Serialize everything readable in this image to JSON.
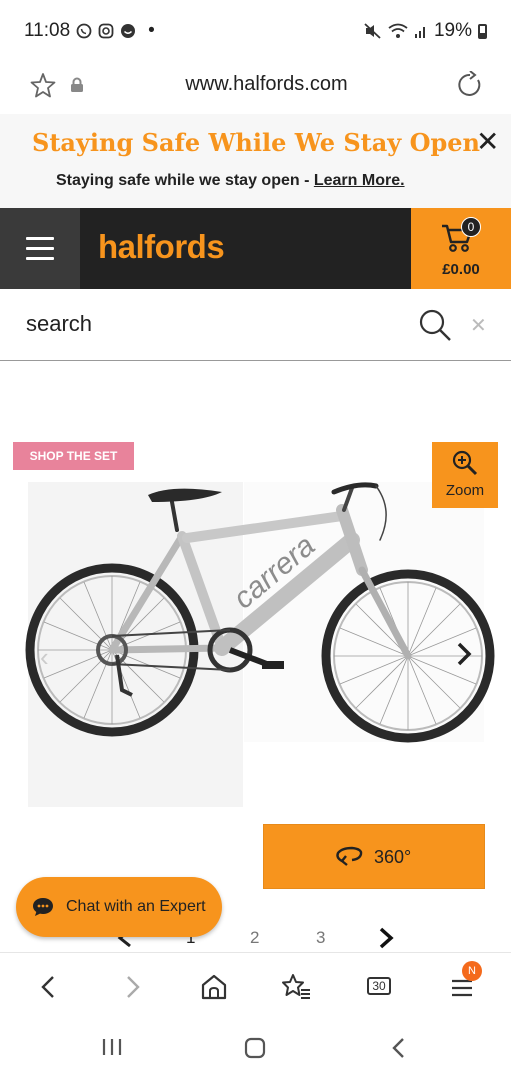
{
  "status_bar": {
    "time": "11:08",
    "dot": "•",
    "battery": "19%"
  },
  "browser": {
    "url": "www.halfords.com"
  },
  "promo": {
    "title": "Staying Safe While We Stay Open",
    "close": "✕",
    "subtitle": "Staying safe while we stay open - ",
    "link": "Learn More."
  },
  "header": {
    "logo": "halfords",
    "cart_count": "0",
    "cart_total": "£0.00"
  },
  "search": {
    "placeholder": "search",
    "clear": "✕"
  },
  "gallery": {
    "shop_the_set": "SHOP THE SET",
    "zoom_label": "Zoom",
    "btn_360_label": "360°",
    "pager": [
      "1",
      "2",
      "3"
    ]
  },
  "chat": {
    "label": "Chat with an Expert"
  },
  "bottom_bar": {
    "tabs": "30",
    "badge": "N"
  },
  "colors": {
    "accent": "#f7941d",
    "header": "#222222",
    "pink": "#e8839b"
  }
}
